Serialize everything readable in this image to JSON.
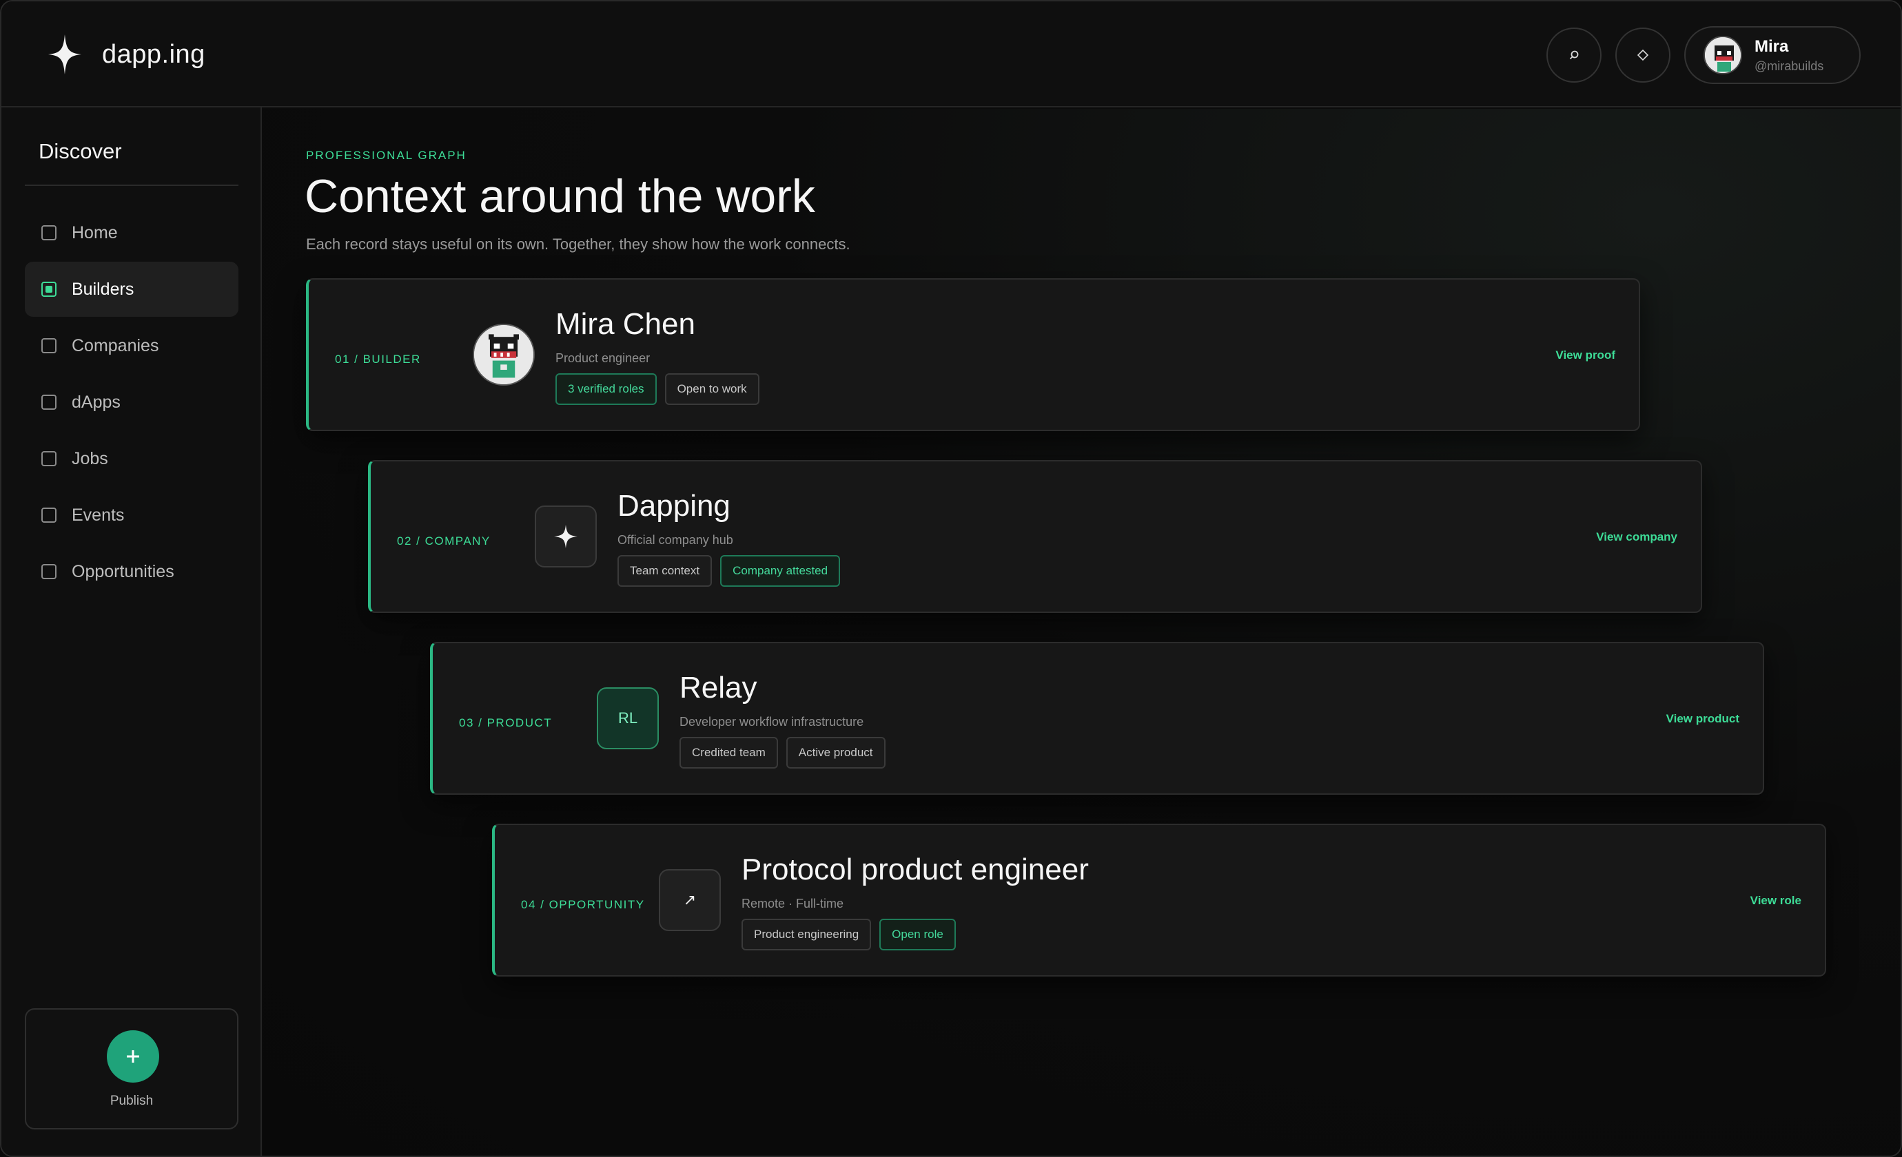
{
  "header": {
    "brand": "dapp.ing",
    "search_icon": "search-icon",
    "wallet_icon": "diamond-icon",
    "profile": {
      "name": "Mira",
      "handle": "@mirabuilds"
    }
  },
  "sidebar": {
    "title": "Discover",
    "items": [
      {
        "label": "Home",
        "active": false
      },
      {
        "label": "Builders",
        "active": true
      },
      {
        "label": "Companies",
        "active": false
      },
      {
        "label": "dApps",
        "active": false
      },
      {
        "label": "Jobs",
        "active": false
      },
      {
        "label": "Events",
        "active": false
      },
      {
        "label": "Opportunities",
        "active": false
      }
    ],
    "publish": {
      "icon": "plus-icon",
      "label": "Publish"
    }
  },
  "main": {
    "eyebrow": "PROFESSIONAL GRAPH",
    "title": "Context around the work",
    "subtitle": "Each record stays useful on its own. Together, they show how the work connects.",
    "cards": [
      {
        "index": "01 / BUILDER",
        "name": "Mira Chen",
        "sub": "Product engineer",
        "chips": [
          {
            "label": "3 verified roles",
            "accent": true
          },
          {
            "label": "Open to work",
            "accent": false
          }
        ],
        "link": "View proof"
      },
      {
        "index": "02 / COMPANY",
        "name": "Dapping",
        "sub": "Official company hub",
        "chips": [
          {
            "label": "Team context",
            "accent": false
          },
          {
            "label": "Company attested",
            "accent": true
          }
        ],
        "link": "View company"
      },
      {
        "index": "03 / PRODUCT",
        "name": "Relay",
        "sub": "Developer workflow infrastructure",
        "icon_text": "RL",
        "chips": [
          {
            "label": "Credited team",
            "accent": false
          },
          {
            "label": "Active product",
            "accent": false
          }
        ],
        "link": "View product"
      },
      {
        "index": "04 / OPPORTUNITY",
        "name": "Protocol product engineer",
        "sub": "Remote · Full-time",
        "icon_text": "↗",
        "chips": [
          {
            "label": "Product engineering",
            "accent": false
          },
          {
            "label": "Open role",
            "accent": true
          }
        ],
        "link": "View role"
      }
    ]
  },
  "colors": {
    "accent": "#3ddc97",
    "background": "#0b0b0b",
    "card": "#171717",
    "publish": "#1fa37a"
  }
}
